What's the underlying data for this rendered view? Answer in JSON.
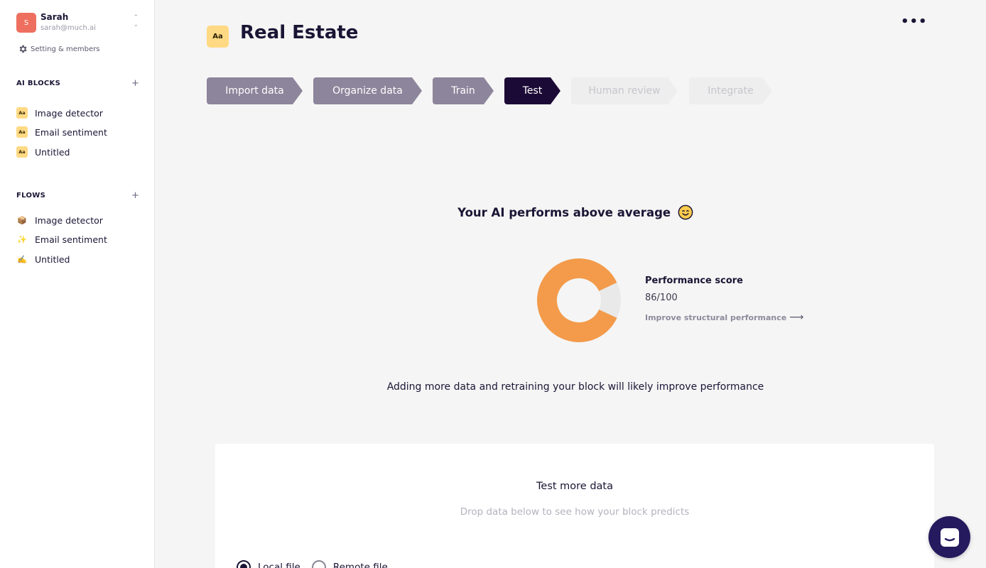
{
  "user": {
    "initial": "S",
    "name": "Sarah",
    "email": "sarah@much.ai",
    "settings_label": "Setting & members"
  },
  "sidebar": {
    "ai_blocks": {
      "title": "AI BLOCKS",
      "add": "+",
      "items": [
        {
          "label": "Image detector",
          "icon": "Aa"
        },
        {
          "label": "Email sentiment",
          "icon": "Aa"
        },
        {
          "label": "Untitled",
          "icon": "Aa"
        }
      ]
    },
    "flows": {
      "title": "FLOWS",
      "add": "+",
      "items": [
        {
          "label": "Image detector",
          "icon": "📦"
        },
        {
          "label": "Email sentiment",
          "icon": "✨"
        },
        {
          "label": "Untitled",
          "icon": "✍️"
        }
      ]
    }
  },
  "header": {
    "chip": "Aa",
    "title": "Real Estate",
    "more": "•••"
  },
  "steps": [
    {
      "label": "Import data",
      "state": "done"
    },
    {
      "label": "Organize data",
      "state": "done"
    },
    {
      "label": "Train",
      "state": "done"
    },
    {
      "label": "Test",
      "state": "active"
    },
    {
      "label": "Human review",
      "state": "todo"
    },
    {
      "label": "Integrate",
      "state": "todo"
    }
  ],
  "result": {
    "headline": "Your AI performs above average",
    "score_label": "Performance score",
    "score_value": "86/100",
    "score_fraction": 0.86,
    "improve_link": "Improve structural performance",
    "advice": "Adding more data and retraining your block will likely improve performance",
    "colors": {
      "score": "#f39b4b",
      "rest": "#e9e9e9"
    }
  },
  "test_card": {
    "title": "Test more data",
    "subtitle": "Drop data below to see how your block predicts",
    "options": [
      {
        "label": "Local file",
        "selected": true
      },
      {
        "label": "Remote file",
        "selected": false
      }
    ]
  }
}
